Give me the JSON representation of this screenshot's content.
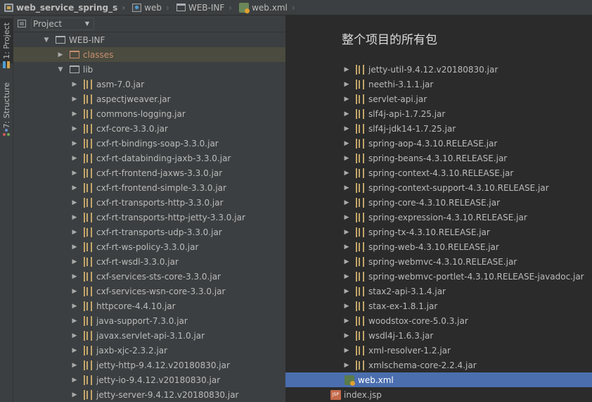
{
  "breadcrumb": [
    {
      "label": "web_service_spring_s",
      "icon": "project-icon"
    },
    {
      "label": "web",
      "icon": "web-folder-icon"
    },
    {
      "label": "WEB-INF",
      "icon": "folder-icon"
    },
    {
      "label": "web.xml",
      "icon": "xml-file-icon"
    }
  ],
  "sidebar": {
    "project_tab": "1: Project",
    "structure_tab": "7: Structure"
  },
  "panel": {
    "view_selector": "Project",
    "tree": {
      "web_inf": "WEB-INF",
      "classes": "classes",
      "lib": "lib",
      "jars": [
        "asm-7.0.jar",
        "aspectjweaver.jar",
        "commons-logging.jar",
        "cxf-core-3.3.0.jar",
        "cxf-rt-bindings-soap-3.3.0.jar",
        "cxf-rt-databinding-jaxb-3.3.0.jar",
        "cxf-rt-frontend-jaxws-3.3.0.jar",
        "cxf-rt-frontend-simple-3.3.0.jar",
        "cxf-rt-transports-http-3.3.0.jar",
        "cxf-rt-transports-http-jetty-3.3.0.jar",
        "cxf-rt-transports-udp-3.3.0.jar",
        "cxf-rt-ws-policy-3.3.0.jar",
        "cxf-rt-wsdl-3.3.0.jar",
        "cxf-services-sts-core-3.3.0.jar",
        "cxf-services-wsn-core-3.3.0.jar",
        "httpcore-4.4.10.jar",
        "java-support-7.3.0.jar",
        "javax.servlet-api-3.1.0.jar",
        "jaxb-xjc-2.3.2.jar",
        "jetty-http-9.4.12.v20180830.jar",
        "jetty-io-9.4.12.v20180830.jar",
        "jetty-server-9.4.12.v20180830.jar"
      ]
    }
  },
  "right": {
    "heading": "整个项目的所有包",
    "jars": [
      "jetty-util-9.4.12.v20180830.jar",
      "neethi-3.1.1.jar",
      "servlet-api.jar",
      "slf4j-api-1.7.25.jar",
      "slf4j-jdk14-1.7.25.jar",
      "spring-aop-4.3.10.RELEASE.jar",
      "spring-beans-4.3.10.RELEASE.jar",
      "spring-context-4.3.10.RELEASE.jar",
      "spring-context-support-4.3.10.RELEASE.jar",
      "spring-core-4.3.10.RELEASE.jar",
      "spring-expression-4.3.10.RELEASE.jar",
      "spring-tx-4.3.10.RELEASE.jar",
      "spring-web-4.3.10.RELEASE.jar",
      "spring-webmvc-4.3.10.RELEASE.jar",
      "spring-webmvc-portlet-4.3.10.RELEASE-javadoc.jar",
      "stax2-api-3.1.4.jar",
      "stax-ex-1.8.1.jar",
      "woodstox-core-5.0.3.jar",
      "wsdl4j-1.6.3.jar",
      "xml-resolver-1.2.jar",
      "xmlschema-core-2.2.4.jar"
    ],
    "web_xml": "web.xml",
    "index_jsp": "index.jsp"
  }
}
